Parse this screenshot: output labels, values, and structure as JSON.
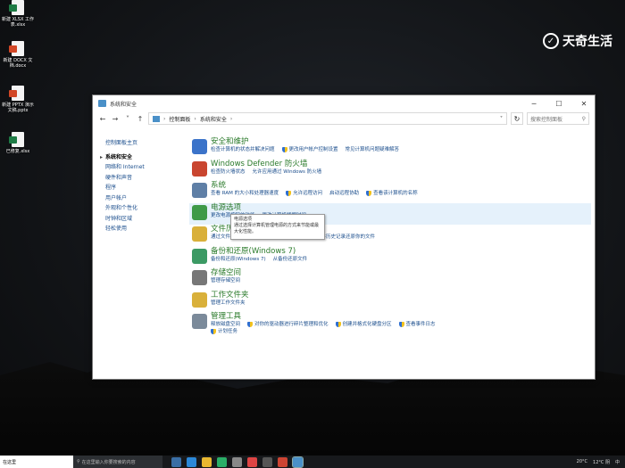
{
  "desktop": {
    "icons": [
      {
        "label": "新建 XLSX 工作表.xlsx",
        "type": "xlsx"
      },
      {
        "label": "新建 DOCX 文档.docx",
        "type": "docx"
      },
      {
        "label": "新建 PPTX 演示文稿.pptx",
        "type": "pptx"
      },
      {
        "label": "已修复.xlsx",
        "type": "xls"
      }
    ],
    "brand": "天奇生活"
  },
  "window": {
    "title": "系统和安全",
    "controls": {
      "minimize": "─",
      "maximize": "☐",
      "close": "✕"
    },
    "nav": {
      "back": "←",
      "forward": "→",
      "recent": "˅",
      "up": "↑"
    },
    "breadcrumb": [
      "控制面板",
      "系统和安全"
    ],
    "search_placeholder": "搜索控制面板",
    "refresh": "↻",
    "dropdown": "˅",
    "search_icon": "⚲"
  },
  "leftnav": {
    "home": "控制面板主页",
    "items": [
      "系统和安全",
      "网络和 Internet",
      "硬件和声音",
      "程序",
      "用户帐户",
      "外观和个性化",
      "时钟和区域",
      "轻松使用"
    ]
  },
  "categories": [
    {
      "title": "安全和维护",
      "color": "#3b73c9",
      "links": [
        "检查计算机的状态并解决问题",
        "更改用户帐户控制设置",
        "常见计算机问题疑难解答"
      ]
    },
    {
      "title": "Windows Defender 防火墙",
      "color": "#c9452f",
      "links": [
        "检查防火墙状态",
        "允许应用通过 Windows 防火墙"
      ]
    },
    {
      "title": "系统",
      "color": "#5f7fa6",
      "links": [
        "查看 RAM 的大小和处理器速度",
        "允许远程访问",
        "启动远程协助",
        "查看该计算机的名称"
      ]
    },
    {
      "title": "电源选项",
      "color": "#3f9a48",
      "links": [
        "更改电源按钮的功能",
        "更改计算机睡眠时间"
      ]
    },
    {
      "title": "文件历史记录",
      "color": "#d9b03a",
      "links": [
        "通过文件历史记录保存你的文件备份副本",
        "使用文件历史记录还原你的文件"
      ]
    },
    {
      "title": "备份和还原(Windows 7)",
      "color": "#3c9a64",
      "links": [
        "备份和还原(Windows 7)",
        "从备份还原文件"
      ]
    },
    {
      "title": "存储空间",
      "color": "#777777",
      "links": [
        "管理存储空间"
      ]
    },
    {
      "title": "工作文件夹",
      "color": "#d9b03a",
      "links": [
        "管理工作文件夹"
      ]
    },
    {
      "title": "管理工具",
      "color": "#7b8a9a",
      "links": [
        "释放磁盘空间",
        "对你的驱动器进行碎片整理和优化",
        "创建并格式化硬盘分区",
        "查看事件日志",
        "计划任务"
      ]
    }
  ],
  "tooltip": {
    "title": "电源选项",
    "text": "通过选择计算机管理电源的方式来节能或最大化性能。"
  },
  "taskbar": {
    "start_text": "在这里",
    "search_placeholder": "在这里输入你要搜索的内容",
    "time": "20°C",
    "weather": "12°C 阴",
    "ime": "中"
  }
}
